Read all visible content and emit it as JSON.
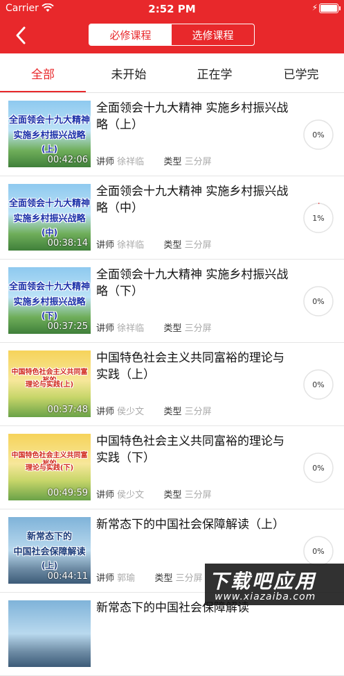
{
  "status_bar": {
    "carrier": "Carrier",
    "time": "2:52 PM"
  },
  "header": {
    "back_icon": "chevron-left-icon",
    "segments": [
      "必修课程",
      "选修课程"
    ],
    "selected_segment": 0
  },
  "tabs": {
    "items": [
      "全部",
      "未开始",
      "正在学",
      "已学完"
    ],
    "selected": 0
  },
  "labels": {
    "lecturer": "讲师",
    "type": "类型"
  },
  "courses": [
    {
      "title": "全面领会十九大精神 实施乡村振兴战略（上）",
      "thumb_lines": [
        "全面领会十九大精神",
        "实施乡村振兴战略",
        "(上)"
      ],
      "duration": "00:42:06",
      "lecturer": "徐祥临",
      "type": "三分屏",
      "progress_text": "0%",
      "progress": 0,
      "theme": "blue"
    },
    {
      "title": "全面领会十九大精神 实施乡村振兴战略（中）",
      "thumb_lines": [
        "全面领会十九大精神",
        "实施乡村振兴战略",
        "(中)"
      ],
      "duration": "00:38:14",
      "lecturer": "徐祥临",
      "type": "三分屏",
      "progress_text": "1%",
      "progress": 0.01,
      "theme": "blue"
    },
    {
      "title": "全面领会十九大精神 实施乡村振兴战略（下）",
      "thumb_lines": [
        "全面领会十九大精神",
        "实施乡村振兴战略",
        "(下)"
      ],
      "duration": "00:37:25",
      "lecturer": "徐祥临",
      "type": "三分屏",
      "progress_text": "0%",
      "progress": 0,
      "theme": "blue"
    },
    {
      "title": "中国特色社会主义共同富裕的理论与实践（上）",
      "thumb_lines": [
        "中国特色社会主义共同富裕的",
        "理论与实践(上)"
      ],
      "duration": "00:37:48",
      "lecturer": "侯少文",
      "type": "三分屏",
      "progress_text": "0%",
      "progress": 0,
      "theme": "gold"
    },
    {
      "title": "中国特色社会主义共同富裕的理论与实践（下）",
      "thumb_lines": [
        "中国特色社会主义共同富裕的",
        "理论与实践(下)"
      ],
      "duration": "00:49:59",
      "lecturer": "侯少文",
      "type": "三分屏",
      "progress_text": "0%",
      "progress": 0,
      "theme": "gold"
    },
    {
      "title": "新常态下的中国社会保障解读（上）",
      "thumb_lines": [
        "新常态下的",
        "中国社会保障解读",
        "(上)"
      ],
      "duration": "00:44:11",
      "lecturer": "郭瑜",
      "type": "三分屏",
      "progress_text": "0%",
      "progress": 0,
      "theme": "city"
    },
    {
      "title": "新常态下的中国社会保障解读",
      "thumb_lines": [],
      "duration": "",
      "lecturer": "",
      "type": "",
      "progress_text": "",
      "progress": 0,
      "theme": "city"
    }
  ],
  "watermark": {
    "text": "下载吧应用",
    "url": "www.xiazaiba.com"
  },
  "colors": {
    "accent": "#e8282b"
  }
}
